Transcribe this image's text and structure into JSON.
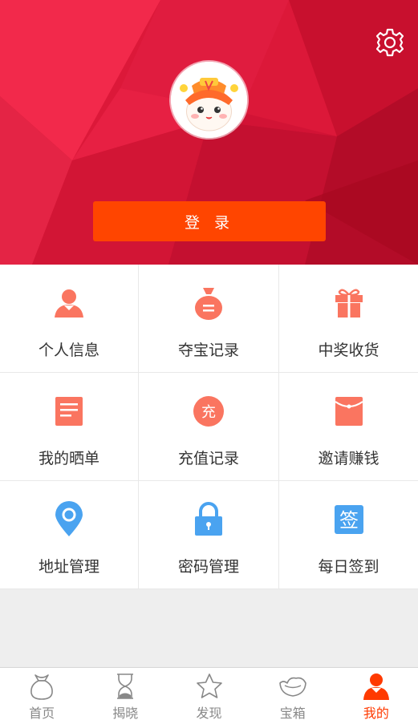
{
  "header": {
    "settings_icon": "gear-icon",
    "avatar_icon": "mascot-avatar-icon",
    "login_label": "登 录",
    "accent": "#d9173a",
    "button_color": "#ff4500"
  },
  "menu": [
    {
      "label": "个人信息",
      "icon": "person-icon",
      "color": "#fa7560"
    },
    {
      "label": "夺宝记录",
      "icon": "money-bag-icon",
      "color": "#fa7560"
    },
    {
      "label": "中奖收货",
      "icon": "gift-icon",
      "color": "#fa7560"
    },
    {
      "label": "我的晒单",
      "icon": "document-icon",
      "color": "#fa7560"
    },
    {
      "label": "充值记录",
      "icon": "recharge-icon",
      "glyph": "充",
      "color": "#fa7560"
    },
    {
      "label": "邀请赚钱",
      "icon": "red-envelope-icon",
      "color": "#fa7560"
    },
    {
      "label": "地址管理",
      "icon": "location-pin-icon",
      "color": "#4aa3f0"
    },
    {
      "label": "密码管理",
      "icon": "lock-icon",
      "color": "#4aa3f0"
    },
    {
      "label": "每日签到",
      "icon": "sign-in-icon",
      "glyph": "签",
      "color": "#4aa3f0"
    }
  ],
  "tabs": [
    {
      "label": "首页",
      "icon": "home-bag-icon",
      "active": false
    },
    {
      "label": "揭晓",
      "icon": "hourglass-icon",
      "active": false
    },
    {
      "label": "发现",
      "icon": "star-icon",
      "active": false
    },
    {
      "label": "宝箱",
      "icon": "treasure-icon",
      "active": false
    },
    {
      "label": "我的",
      "icon": "profile-icon",
      "active": true
    }
  ],
  "tab_active_color": "#ff3a00"
}
